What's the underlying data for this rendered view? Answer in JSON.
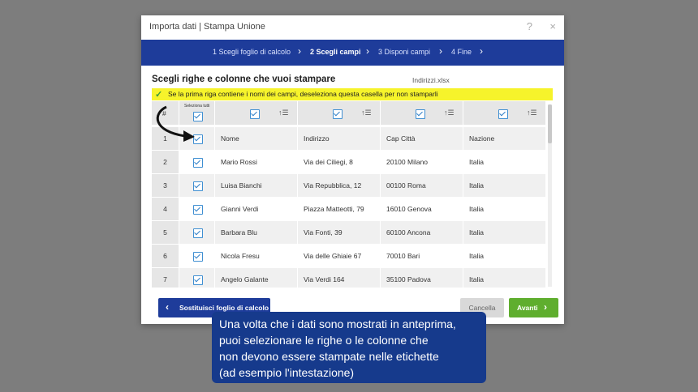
{
  "dialog": {
    "title": "Importa dati | Stampa Unione",
    "help": "?",
    "close": "×",
    "steps": [
      {
        "label": "1 Scegli foglio di calcolo"
      },
      {
        "label": "2 Scegli campi"
      },
      {
        "label": "3 Disponi campi"
      },
      {
        "label": "4 Fine"
      }
    ],
    "heading": "Scegli righe e colonne che vuoi stampare",
    "filename": "Indirizzi.xlsx",
    "first_row_notice": "Se la prima riga contiene i nomi dei campi, deseleziona questa casella per non stamparli",
    "select_all_label": "Seleziona tutti",
    "column_hash": "#",
    "rows": [
      {
        "n": "1",
        "c1": "Nome",
        "c2": "Indirizzo",
        "c3": "Cap Città",
        "c4": "Nazione"
      },
      {
        "n": "2",
        "c1": "Mario Rossi",
        "c2": "Via dei Ciliegi, 8",
        "c3": "20100 Milano",
        "c4": "Italia"
      },
      {
        "n": "3",
        "c1": "Luisa Bianchi",
        "c2": "Via Repubblica, 12",
        "c3": "00100 Roma",
        "c4": "Italia"
      },
      {
        "n": "4",
        "c1": "Gianni Verdi",
        "c2": "Piazza Matteotti, 79",
        "c3": "16010 Genova",
        "c4": "Italia"
      },
      {
        "n": "5",
        "c1": "Barbara Blu",
        "c2": "Via Fonti, 39",
        "c3": "60100 Ancona",
        "c4": "Italia"
      },
      {
        "n": "6",
        "c1": "Nicola Fresu",
        "c2": "Via delle Ghiaie 67",
        "c3": "70010 Bari",
        "c4": "Italia"
      },
      {
        "n": "7",
        "c1": "Angelo Galante",
        "c2": "Via Verdi 164",
        "c3": "35100 Padova",
        "c4": "Italia"
      }
    ],
    "buttons": {
      "replace": "Sostituisci foglio di calcolo",
      "cancel": "Cancella",
      "next": "Avanti"
    },
    "colors": {
      "primary": "#1e3c9a",
      "next": "#5fae2e",
      "highlight": "#f6f32b"
    }
  },
  "caption": {
    "lines": [
      "Una volta che i dati sono mostrati in anteprima,",
      "puoi selezionare le righe o le colonne che",
      "non devono essere stampate nelle etichette",
      "(ad esempio l'intestazione)"
    ]
  }
}
